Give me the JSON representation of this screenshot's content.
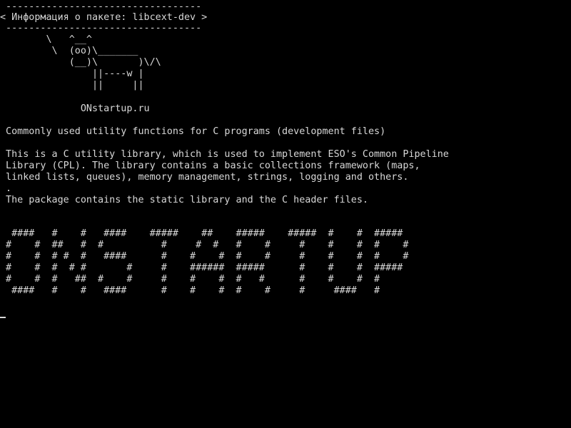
{
  "colors": {
    "background": "#000000",
    "text": "#d8d8d8"
  },
  "speech_bubble": {
    "top_border": " ----------------------------------",
    "title": "< Информация о пакете: libcext-dev >",
    "bottom_border": " ----------------------------------"
  },
  "cow_art": [
    "        \\   ^__^",
    "         \\  (oo)\\_______",
    "            (__)\\       )\\/\\",
    "                ||----w |",
    "                ||     ||"
  ],
  "site": "              ONstartup.ru",
  "description": {
    "summary": " Commonly used utility functions for C programs (development files)",
    "body": [
      " This is a C utility library, which is used to implement ESO's Common Pipeline",
      " Library (CPL). The library contains a basic collections framework (maps,",
      " linked lists, queues), memory management, strings, logging and others.",
      " .",
      " The package contains the static library and the C header files."
    ]
  },
  "banner": [
    "  ####   #    #   ####    #####    ##    #####    #####  #    #  #####",
    " #    #  ##   #  #          #     #  #   #    #     #    #    #  #    #",
    " #    #  # #  #   ####      #    #    #  #    #     #    #    #  #    #",
    " #    #  #  # #       #     #    ######  #####      #    #    #  #####",
    " #    #  #   ##  #    #     #    #    #  #   #      #    #    #  #",
    "  ####   #    #   ####      #    #    #  #    #     #     ####   #"
  ]
}
